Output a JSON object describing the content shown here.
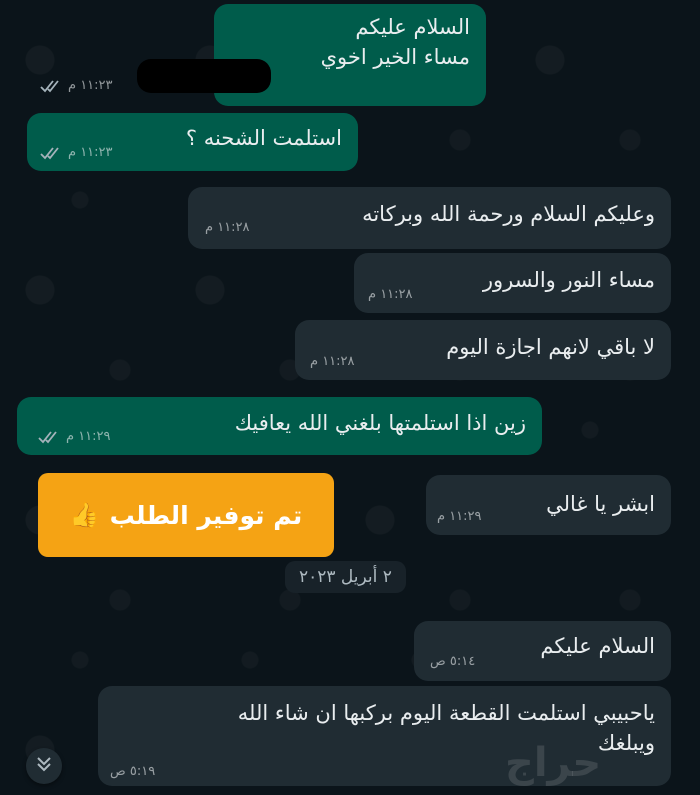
{
  "messages": [
    {
      "id": "m1",
      "dir": "out",
      "lines": "السلام عليكم\nمساء الخير اخوي",
      "time": "١١:٢٣ م"
    },
    {
      "id": "m2",
      "dir": "out",
      "lines": "استلمت الشحنه ؟",
      "time": "١١:٢٣ م"
    },
    {
      "id": "m3",
      "dir": "in",
      "lines": "وعليكم السلام ورحمة الله وبركاته",
      "time": "١١:٢٨ م"
    },
    {
      "id": "m4",
      "dir": "in",
      "lines": "مساء النور والسرور",
      "time": "١١:٢٨ م"
    },
    {
      "id": "m5",
      "dir": "in",
      "lines": "لا باقي لانهم اجازة اليوم",
      "time": "١١:٢٨ م"
    },
    {
      "id": "m6",
      "dir": "out",
      "lines": "زين اذا استلمتها بلغني الله يعافيك",
      "time": "١١:٢٩ م"
    },
    {
      "id": "m7",
      "dir": "in",
      "lines": "ابشر يا غالي",
      "time": "١١:٢٩ م"
    },
    {
      "id": "m8",
      "dir": "in",
      "lines": "السلام عليكم",
      "time": "٥:١٤ ص"
    },
    {
      "id": "m9",
      "dir": "in",
      "lines": "ياحبيبي استلمت القطعة اليوم بركبها ان شاء الله\nويبلغك",
      "time": "٥:١٩ ص"
    }
  ],
  "overlay": {
    "text": "تم توفير الطلب",
    "emoji": "👍"
  },
  "date_separator": "٢ أبريل ٢٠٢٣",
  "watermark": "حراج",
  "colors": {
    "outgoing": "#005c4b",
    "incoming": "#202c33",
    "overlay": "#f5a314",
    "background": "#0b141a"
  },
  "icons": {
    "read_ticks": "double-check-icon",
    "scroll": "chevron-double-down-icon"
  }
}
